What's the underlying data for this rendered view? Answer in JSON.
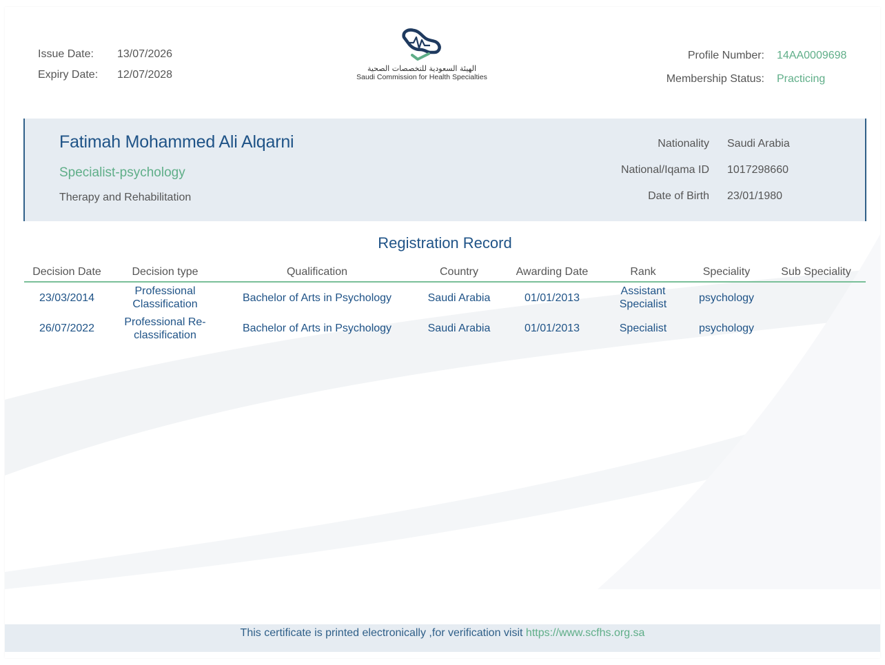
{
  "header": {
    "issue_label": "Issue Date:",
    "issue_value": "13/07/2026",
    "expiry_label": "Expiry Date:",
    "expiry_value": "12/07/2028",
    "profile_label": "Profile Number:",
    "profile_value": "14AA0009698",
    "status_label": "Membership Status:",
    "status_value": "Practicing"
  },
  "logo": {
    "arabic_name": "الهيئة السعودية للتخصصات الصحية",
    "english_name": "Saudi Commission for Health Specialties",
    "colors": {
      "outline": "#1f3a5f",
      "check": "#5fae88"
    }
  },
  "person": {
    "name": "Fatimah Mohammed Ali Alqarni",
    "specialty": "Specialist-psychology",
    "department": "Therapy and Rehabilitation",
    "nationality_label": "Nationality",
    "nationality_value": "Saudi Arabia",
    "id_label": "National/Iqama ID",
    "id_value": "1017298660",
    "dob_label": "Date of Birth",
    "dob_value": "23/01/1980"
  },
  "record": {
    "title": "Registration Record",
    "columns": [
      "Decision Date",
      "Decision type",
      "Qualification",
      "Country",
      "Awarding Date",
      "Rank",
      "Speciality",
      "Sub Speciality"
    ],
    "rows": [
      [
        "23/03/2014",
        "Professional Classification",
        "Bachelor of Arts in Psychology",
        "Saudi Arabia",
        "01/01/2013",
        "Assistant Specialist",
        "psychology",
        ""
      ],
      [
        "26/07/2022",
        "Professional Re-classification",
        "Bachelor of Arts in Psychology",
        "Saudi Arabia",
        "01/01/2013",
        "Specialist",
        "psychology",
        ""
      ]
    ]
  },
  "footer": {
    "text": "This certificate is printed electronically ,for verification visit ",
    "link": "https://www.scfhs.org.sa"
  },
  "colors": {
    "title_blue": "#1f5387",
    "accent_green": "#5fae88",
    "card_bg": "#e6ecf2"
  }
}
